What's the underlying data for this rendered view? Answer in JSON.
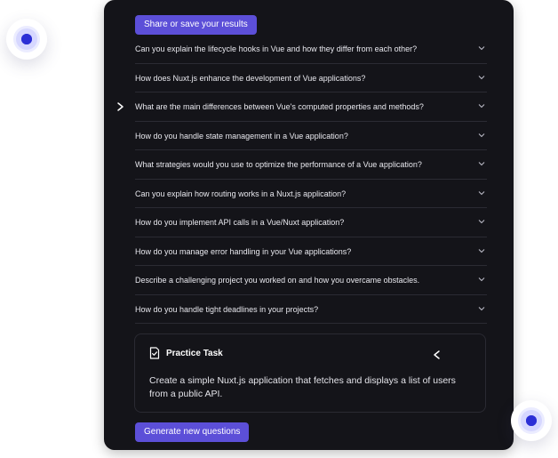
{
  "share_button_label": "Share or save your results",
  "questions": [
    "Can you explain the lifecycle hooks in Vue and how they differ from each other?",
    "How does Nuxt.js enhance the development of Vue applications?",
    "What are the main differences between Vue's computed properties and methods?",
    "How do you handle state management in a Vue application?",
    "What strategies would you use to optimize the performance of a Vue application?",
    "Can you explain how routing works in a Nuxt.js application?",
    "How do you implement API calls in a Vue/Nuxt application?",
    "How do you manage error handling in your Vue applications?",
    "Describe a challenging project you worked on and how you overcame obstacles.",
    "How do you handle tight deadlines in your projects?"
  ],
  "practice_task": {
    "title": "Practice Task",
    "description": "Create a simple Nuxt.js application that fetches and displays a list of users from a public API."
  },
  "generate_button_label": "Generate new questions",
  "colors": {
    "panel_bg": "#141419",
    "accent": "#5c4fd8",
    "dot_core": "#2c2fd6"
  },
  "icons": {
    "chevron": "chevron-down-icon",
    "task": "clipboard-check-icon",
    "connector": "arrow-right-icon"
  }
}
